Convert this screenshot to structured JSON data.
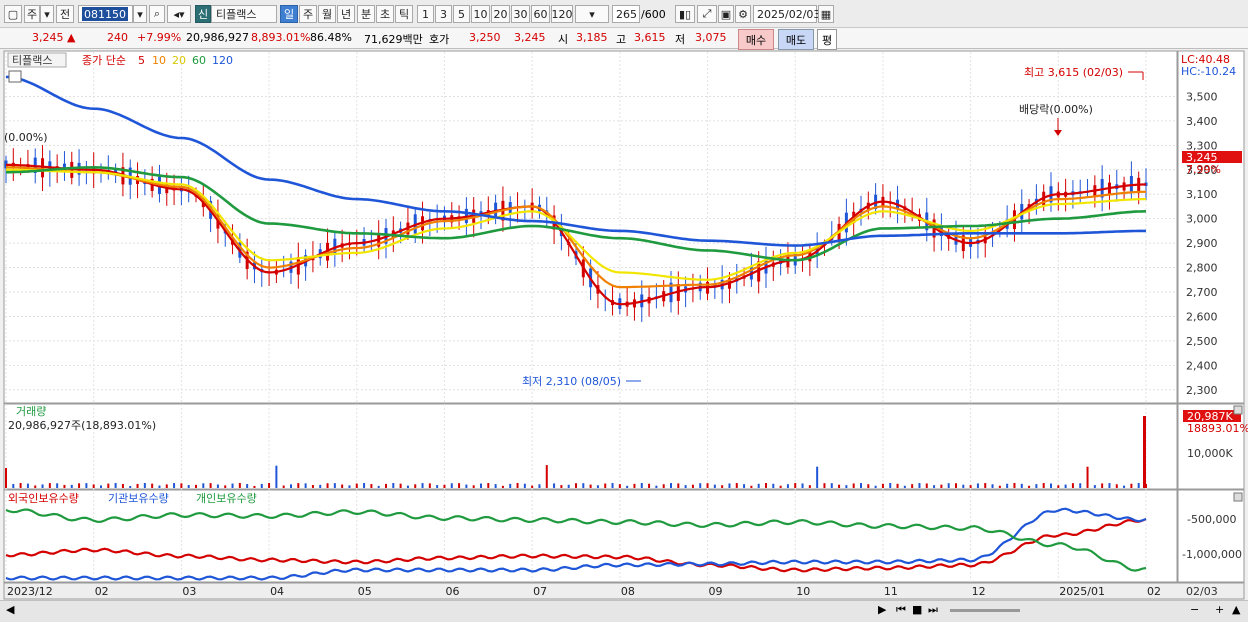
{
  "toolbar": {
    "market_label": "주",
    "prev_label": "전",
    "stock_code": "081150",
    "new_badge": "신",
    "stock_name": "티플랙스",
    "periods": [
      "일",
      "주",
      "월",
      "년",
      "분",
      "초",
      "틱"
    ],
    "numbers": [
      "1",
      "3",
      "5",
      "10",
      "20",
      "30",
      "60",
      "120"
    ],
    "count_display": "265",
    "count_total": "/600",
    "date": "2025/02/03"
  },
  "quote": {
    "price": "3,245",
    "arrow": "▲",
    "change": "240",
    "change_pct": "+7.99%",
    "volume": "20,986,927",
    "volume_ratio": "8,893.01%",
    "turnover": "86.48%",
    "amount": "71,629백만",
    "hoga_label": "호가",
    "hoga_ask": "3,250",
    "hoga_bid": "3,245",
    "open_label": "시",
    "open": "3,185",
    "high_label": "고",
    "high": "3,615",
    "low_label": "저",
    "low": "3,075",
    "buy_label": "매수",
    "sell_label": "매도",
    "avg_label": "평"
  },
  "price_panel": {
    "legend_name": "티플랙스",
    "legend_ma": "종가 단순",
    "ma_periods": [
      "5",
      "10",
      "20",
      "60",
      "120"
    ],
    "ma_colors": [
      "#d40000",
      "#f08000",
      "#f2e600",
      "#1f9a3e",
      "#1f56d8"
    ],
    "left_label": "(0.00%)",
    "lc": "LC:40.48",
    "hc": "HC:-10.24",
    "high_annotation": "최고 3,615 (02/03)",
    "low_annotation": "최저 2,310 (08/05)",
    "dividend_annotation": "배당락(0.00%)",
    "current_price": "3,245",
    "current_pct": "7.99%",
    "y_ticks": [
      "3,500",
      "3,400",
      "3,300",
      "3,200",
      "3,100",
      "3,000",
      "2,900",
      "2,800",
      "2,700",
      "2,600",
      "2,500",
      "2,400",
      "2,300"
    ]
  },
  "volume_panel": {
    "title": "거래량",
    "subtitle": "20,986,927주(18,893.01%)",
    "badge_value": "20,987K",
    "badge_pct": "18893.01%",
    "y_tick": "10,000K"
  },
  "holdings_panel": {
    "legend_foreign": "외국인보유수량",
    "legend_institution": "기관보유수량",
    "legend_individual": "개인보유수량",
    "y_ticks": [
      "-500,000",
      "-1,000,000"
    ]
  },
  "x_axis": {
    "labels": [
      "2023/12",
      "02",
      "03",
      "04",
      "05",
      "06",
      "07",
      "08",
      "09",
      "10",
      "11",
      "12",
      "2025/01",
      "02"
    ],
    "right_label": "02/03"
  },
  "colors": {
    "up": "#d40000",
    "down": "#1f56d8",
    "accent": "#2b6e73"
  },
  "chart_data": [
    {
      "type": "line",
      "title": "",
      "xlabel": "",
      "ylabel": "",
      "ylim": [
        2250,
        3600
      ],
      "x": [
        "2023/12",
        "02",
        "03",
        "04",
        "05",
        "06",
        "07",
        "08",
        "09",
        "10",
        "11",
        "12",
        "2025/01",
        "02"
      ],
      "series": [
        {
          "name": "5",
          "values": [
            3220,
            3200,
            3120,
            2780,
            2900,
            3000,
            3050,
            2650,
            2720,
            2830,
            3070,
            2900,
            3100,
            3140
          ]
        },
        {
          "name": "10",
          "values": [
            3210,
            3190,
            3130,
            2800,
            2880,
            2990,
            3050,
            2720,
            2730,
            2850,
            3050,
            2920,
            3080,
            3110
          ]
        },
        {
          "name": "20",
          "values": [
            3200,
            3190,
            3140,
            2830,
            2860,
            2960,
            3030,
            2780,
            2750,
            2860,
            3030,
            2950,
            3060,
            3080
          ]
        },
        {
          "name": "60",
          "values": [
            3190,
            3210,
            3170,
            2980,
            2940,
            2920,
            2970,
            2920,
            2870,
            2830,
            2960,
            2970,
            3000,
            3030
          ]
        },
        {
          "name": "120",
          "values": [
            3580,
            3450,
            3330,
            3160,
            3080,
            3030,
            2990,
            2950,
            2910,
            2890,
            2930,
            2940,
            2940,
            2950
          ]
        }
      ],
      "annotations": [
        "최고 3,615 (02/03)",
        "최저 2,310 (08/05)",
        "배당락(0.00%)"
      ]
    }
  ]
}
